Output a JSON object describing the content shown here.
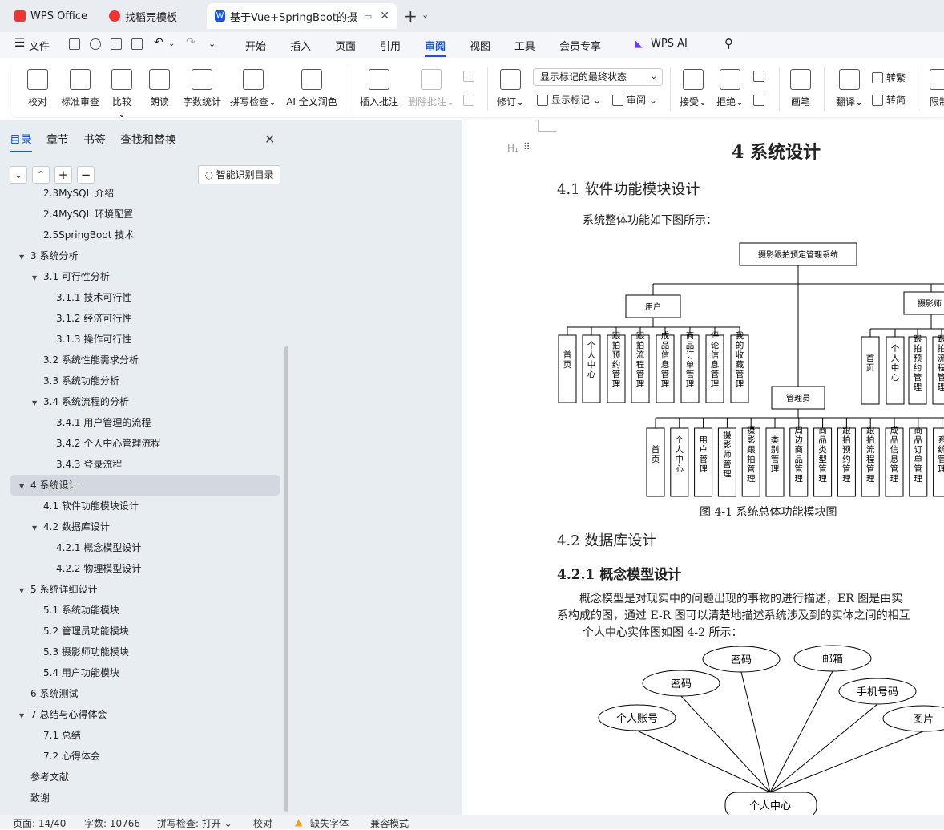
{
  "tabs": [
    {
      "label": "WPS Office"
    },
    {
      "label": "找稻壳模板"
    },
    {
      "label": "基于Vue+SpringBoot的摄影"
    }
  ],
  "menu": {
    "file": "文件",
    "items": [
      "开始",
      "插入",
      "页面",
      "引用",
      "审阅",
      "视图",
      "工具",
      "会员专享"
    ],
    "wps_ai": "WPS AI"
  },
  "ribbon": {
    "proofread": "校对",
    "standard_review": "标准审查",
    "compare": "比较",
    "read_aloud": "朗读",
    "word_count": "字数统计",
    "spell_check": "拼写检查",
    "ai_polish": "AI 全文润色",
    "insert_comment": "插入批注",
    "delete_comment": "删除批注",
    "revise": "修订",
    "markup_select": "显示标记的最终状态",
    "show_markup": "显示标记",
    "review": "审阅",
    "accept": "接受",
    "reject": "拒绝",
    "brush": "画笔",
    "translate": "翻译",
    "to_traditional": "转繁",
    "to_simplified": "转简",
    "limit": "限制"
  },
  "nav": {
    "tabs": [
      "目录",
      "章节",
      "书签",
      "查找和替换"
    ],
    "smart_toc": "智能识别目录"
  },
  "toc": [
    {
      "label": "2.3MySQL 介绍",
      "level": 2
    },
    {
      "label": "2.4MySQL 环境配置",
      "level": 2
    },
    {
      "label": "2.5SpringBoot 技术",
      "level": 2
    },
    {
      "label": "3 系统分析",
      "level": 1,
      "expanded": true
    },
    {
      "label": "3.1 可行性分析",
      "level": 2,
      "expanded": true
    },
    {
      "label": "3.1.1 技术可行性",
      "level": 3
    },
    {
      "label": "3.1.2 经济可行性",
      "level": 3
    },
    {
      "label": "3.1.3 操作可行性",
      "level": 3
    },
    {
      "label": "3.2 系统性能需求分析",
      "level": 2
    },
    {
      "label": "3.3 系统功能分析",
      "level": 2
    },
    {
      "label": "3.4 系统流程的分析",
      "level": 2,
      "expanded": true
    },
    {
      "label": "3.4.1  用户管理的流程",
      "level": 3
    },
    {
      "label": "3.4.2 个人中心管理流程",
      "level": 3
    },
    {
      "label": "3.4.3 登录流程",
      "level": 3
    },
    {
      "label": "4 系统设计",
      "level": 1,
      "expanded": true,
      "selected": true
    },
    {
      "label": "4.1  软件功能模块设计",
      "level": 2
    },
    {
      "label": "4.2 数据库设计",
      "level": 2,
      "expanded": true
    },
    {
      "label": "4.2.1 概念模型设计",
      "level": 3
    },
    {
      "label": "4.2.2 物理模型设计",
      "level": 3
    },
    {
      "label": "5 系统详细设计",
      "level": 1,
      "expanded": true
    },
    {
      "label": "5.1 系统功能模块",
      "level": 2
    },
    {
      "label": "5.2 管理员功能模块",
      "level": 2
    },
    {
      "label": "5.3 摄影师功能模块",
      "level": 2
    },
    {
      "label": "5.4 用户功能模块",
      "level": 2
    },
    {
      "label": "6 系统测试",
      "level": 1
    },
    {
      "label": "7 总结与心得体会",
      "level": 1,
      "expanded": true
    },
    {
      "label": "7.1  总结",
      "level": 2
    },
    {
      "label": "7.2  心得体会",
      "level": 2
    },
    {
      "label": "参考文献",
      "level": 1
    },
    {
      "label": "致谢",
      "level": 1
    }
  ],
  "doc": {
    "heading_marker": "H₁",
    "chapter": "4 系统设计",
    "s41": "4.1  软件功能模块设计",
    "p1": "系统整体功能如下图所示：",
    "root": "摄影跟拍预定管理系统",
    "user": "用户",
    "photographer": "摄影师",
    "admin": "管理员",
    "user_leaves": [
      "首页",
      "个人中心",
      "跟拍预约管理",
      "跟拍流程管理",
      "成品信息管理",
      "商品订单管理",
      "评论信息管理",
      "我的收藏管理"
    ],
    "photographer_leaves": [
      "首页",
      "个人中心",
      "跟拍预约管理",
      "跟拍流程管理"
    ],
    "admin_leaves": [
      "首页",
      "个人中心",
      "用户管理",
      "摄影师管理",
      "摄影跟拍管理",
      "类别管理",
      "周边商品管理",
      "商品类型管理",
      "跟拍预约管理",
      "跟拍流程管理",
      "成品信息管理",
      "商品订单管理",
      "系统管理"
    ],
    "caption": "图  4-1 系统总体功能模块图",
    "s42": "4.2 数据库设计",
    "s421": "4.2.1 概念模型设计",
    "p2a": "概念模型是对现实中的问题出现的事物的进行描述，ER 图是由实",
    "p2b": "系构成的图，通过 E-R 图可以清楚地描述系统涉及到的实体之间的相互",
    "p3": "个人中心实体图如图 4-2 所示：",
    "er_center": "个人中心",
    "er_attrs": [
      "个人账号",
      "密码",
      "密码",
      "邮箱",
      "手机号码",
      "图片"
    ]
  },
  "status": {
    "page": "页面: 14/40",
    "words": "字数: 10766",
    "spell": "拼写检查: 打开 ⌄",
    "proof": "校对",
    "missing_font": "缺失字体",
    "compat": "兼容模式"
  },
  "colors": {
    "accent": "#1a56d6",
    "wps_red": "#e33",
    "warn": "#f0a020"
  }
}
